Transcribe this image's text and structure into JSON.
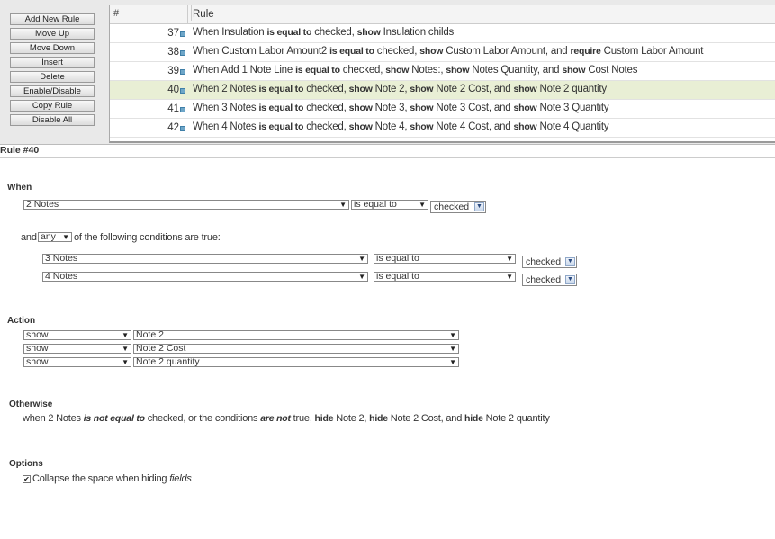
{
  "toolbar": {
    "buttons": [
      "Add New Rule",
      "Move Up",
      "Move Down",
      "Insert",
      "Delete",
      "Enable/Disable",
      "Copy Rule",
      "Disable All"
    ]
  },
  "table": {
    "headers": [
      "#",
      "Rule"
    ],
    "rows": [
      {
        "num": "37",
        "parts": [
          "When Insulation ",
          "is equal to",
          " checked, ",
          "show",
          " Insulation childs"
        ]
      },
      {
        "num": "38",
        "parts": [
          "When Custom Labor Amount2 ",
          "is equal to",
          " checked, ",
          "show",
          " Custom Labor Amount, and ",
          "require",
          " Custom Labor Amount"
        ]
      },
      {
        "num": "39",
        "parts": [
          "When Add 1 Note Line ",
          "is equal to",
          " checked, ",
          "show",
          " Notes:, ",
          "show",
          " Notes Quantity, and ",
          "show",
          " Cost Notes"
        ]
      },
      {
        "num": "40",
        "selected": true,
        "parts": [
          "When 2 Notes ",
          "is equal to",
          " checked, ",
          "show",
          " Note 2, ",
          "show",
          " Note 2 Cost, and ",
          "show",
          " Note 2 quantity"
        ]
      },
      {
        "num": "41",
        "parts": [
          "When 3 Notes ",
          "is equal to",
          " checked, ",
          "show",
          " Note 3, ",
          "show",
          " Note 3 Cost, and ",
          "show",
          " Note 3 Quantity"
        ]
      },
      {
        "num": "42",
        "parts": [
          "When 4 Notes ",
          "is equal to",
          " checked, ",
          "show",
          " Note 4, ",
          "show",
          " Note 4 Cost, and ",
          "show",
          " Note 4 Quantity"
        ]
      }
    ]
  },
  "rule_title": "Rule #40",
  "when": {
    "heading": "When",
    "field": "2 Notes",
    "operator": "is equal to",
    "value": "checked",
    "and_label": "and",
    "match": "any",
    "conditions_suffix": "of the following conditions are true:",
    "conditions": [
      {
        "field": "3 Notes",
        "operator": "is equal to",
        "value": "checked"
      },
      {
        "field": "4 Notes",
        "operator": "is equal to",
        "value": "checked"
      }
    ]
  },
  "action": {
    "heading": "Action",
    "items": [
      {
        "action": "show",
        "target": "Note 2"
      },
      {
        "action": "show",
        "target": "Note 2 Cost"
      },
      {
        "action": "show",
        "target": "Note 2 quantity"
      }
    ]
  },
  "otherwise": {
    "heading": "Otherwise",
    "parts": [
      {
        "t": "when 2 Notes ",
        "s": ""
      },
      {
        "t": "is not equal to",
        "s": "bi"
      },
      {
        "t": " checked, or the conditions ",
        "s": ""
      },
      {
        "t": "are not",
        "s": "bi"
      },
      {
        "t": " true, ",
        "s": ""
      },
      {
        "t": "hide",
        "s": "b"
      },
      {
        "t": " Note 2, ",
        "s": ""
      },
      {
        "t": "hide",
        "s": "b"
      },
      {
        "t": " Note 2 Cost, and ",
        "s": ""
      },
      {
        "t": "hide",
        "s": "b"
      },
      {
        "t": " Note 2 quantity",
        "s": ""
      }
    ]
  },
  "options": {
    "heading": "Options",
    "collapse_checked": true,
    "collapse_label": "Collapse the space when hiding ",
    "collapse_label_em": "fields"
  }
}
